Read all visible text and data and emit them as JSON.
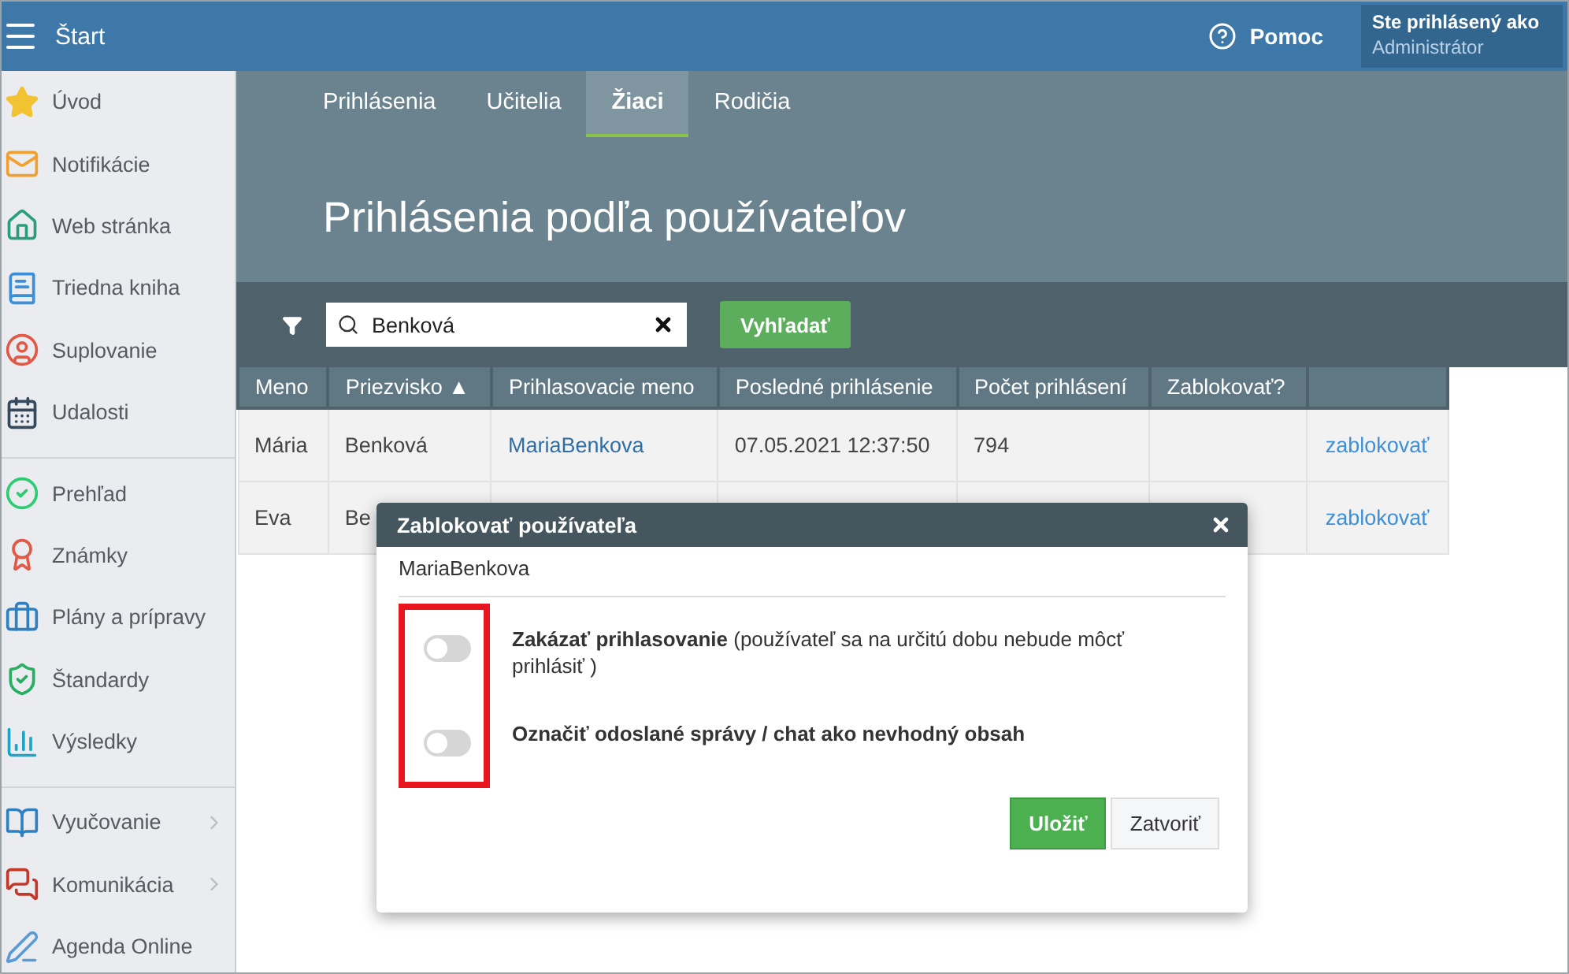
{
  "topbar": {
    "title": "Štart",
    "help": "Pomoc",
    "user_label": "Ste prihlásený ako",
    "user_name": "Administrátor"
  },
  "sidebar": {
    "groups": [
      {
        "items": [
          {
            "label": "Úvod",
            "has_submenu": false
          },
          {
            "label": "Notifikácie",
            "has_submenu": false
          },
          {
            "label": "Web stránka",
            "has_submenu": false
          },
          {
            "label": "Triedna kniha",
            "has_submenu": false
          },
          {
            "label": "Suplovanie",
            "has_submenu": false
          },
          {
            "label": "Udalosti",
            "has_submenu": false
          }
        ]
      },
      {
        "items": [
          {
            "label": "Prehľad",
            "has_submenu": false
          },
          {
            "label": "Známky",
            "has_submenu": false
          },
          {
            "label": "Plány a prípravy",
            "has_submenu": false
          },
          {
            "label": "Štandardy",
            "has_submenu": false
          },
          {
            "label": "Výsledky",
            "has_submenu": false
          }
        ]
      },
      {
        "items": [
          {
            "label": "Vyučovanie",
            "has_submenu": true
          },
          {
            "label": "Komunikácia",
            "has_submenu": true
          },
          {
            "label": "Agenda Online",
            "has_submenu": false
          }
        ]
      }
    ]
  },
  "tabs": [
    {
      "label": "Prihlásenia",
      "selected": false
    },
    {
      "label": "Učitelia",
      "selected": false
    },
    {
      "label": "Žiaci",
      "selected": true
    },
    {
      "label": "Rodičia",
      "selected": false
    }
  ],
  "heading": "Prihlásenia podľa používateľov",
  "search": {
    "value": "Benková",
    "button": "Vyhľadať"
  },
  "table": {
    "columns": [
      "Meno",
      "Priezvisko ▲",
      "Prihlasovacie meno",
      "Posledné prihlásenie",
      "Počet prihlásení",
      "Zablokovať?",
      ""
    ],
    "rows": [
      {
        "cells": [
          "Mária",
          "Benková",
          "MariaBenkova",
          "07.05.2021 12:37:50",
          "794",
          "",
          ""
        ],
        "action": "zablokovať"
      },
      {
        "cells": [
          "Eva",
          "Be",
          "",
          "",
          "",
          "",
          ""
        ],
        "action": "zablokovať"
      }
    ]
  },
  "dialog": {
    "title": "Zablokovať používateľa",
    "username": "MariaBenkova",
    "options": [
      {
        "label": "**Zakázať prihlasovanie** (používateľ sa na určitú dobu nebude môcť prihlásiť )",
        "on": false
      },
      {
        "label": "**Označiť odoslané správy / chat ako nevhodný obsah**",
        "on": false
      }
    ],
    "save": "Uložiť",
    "close": "Zatvoriť"
  }
}
